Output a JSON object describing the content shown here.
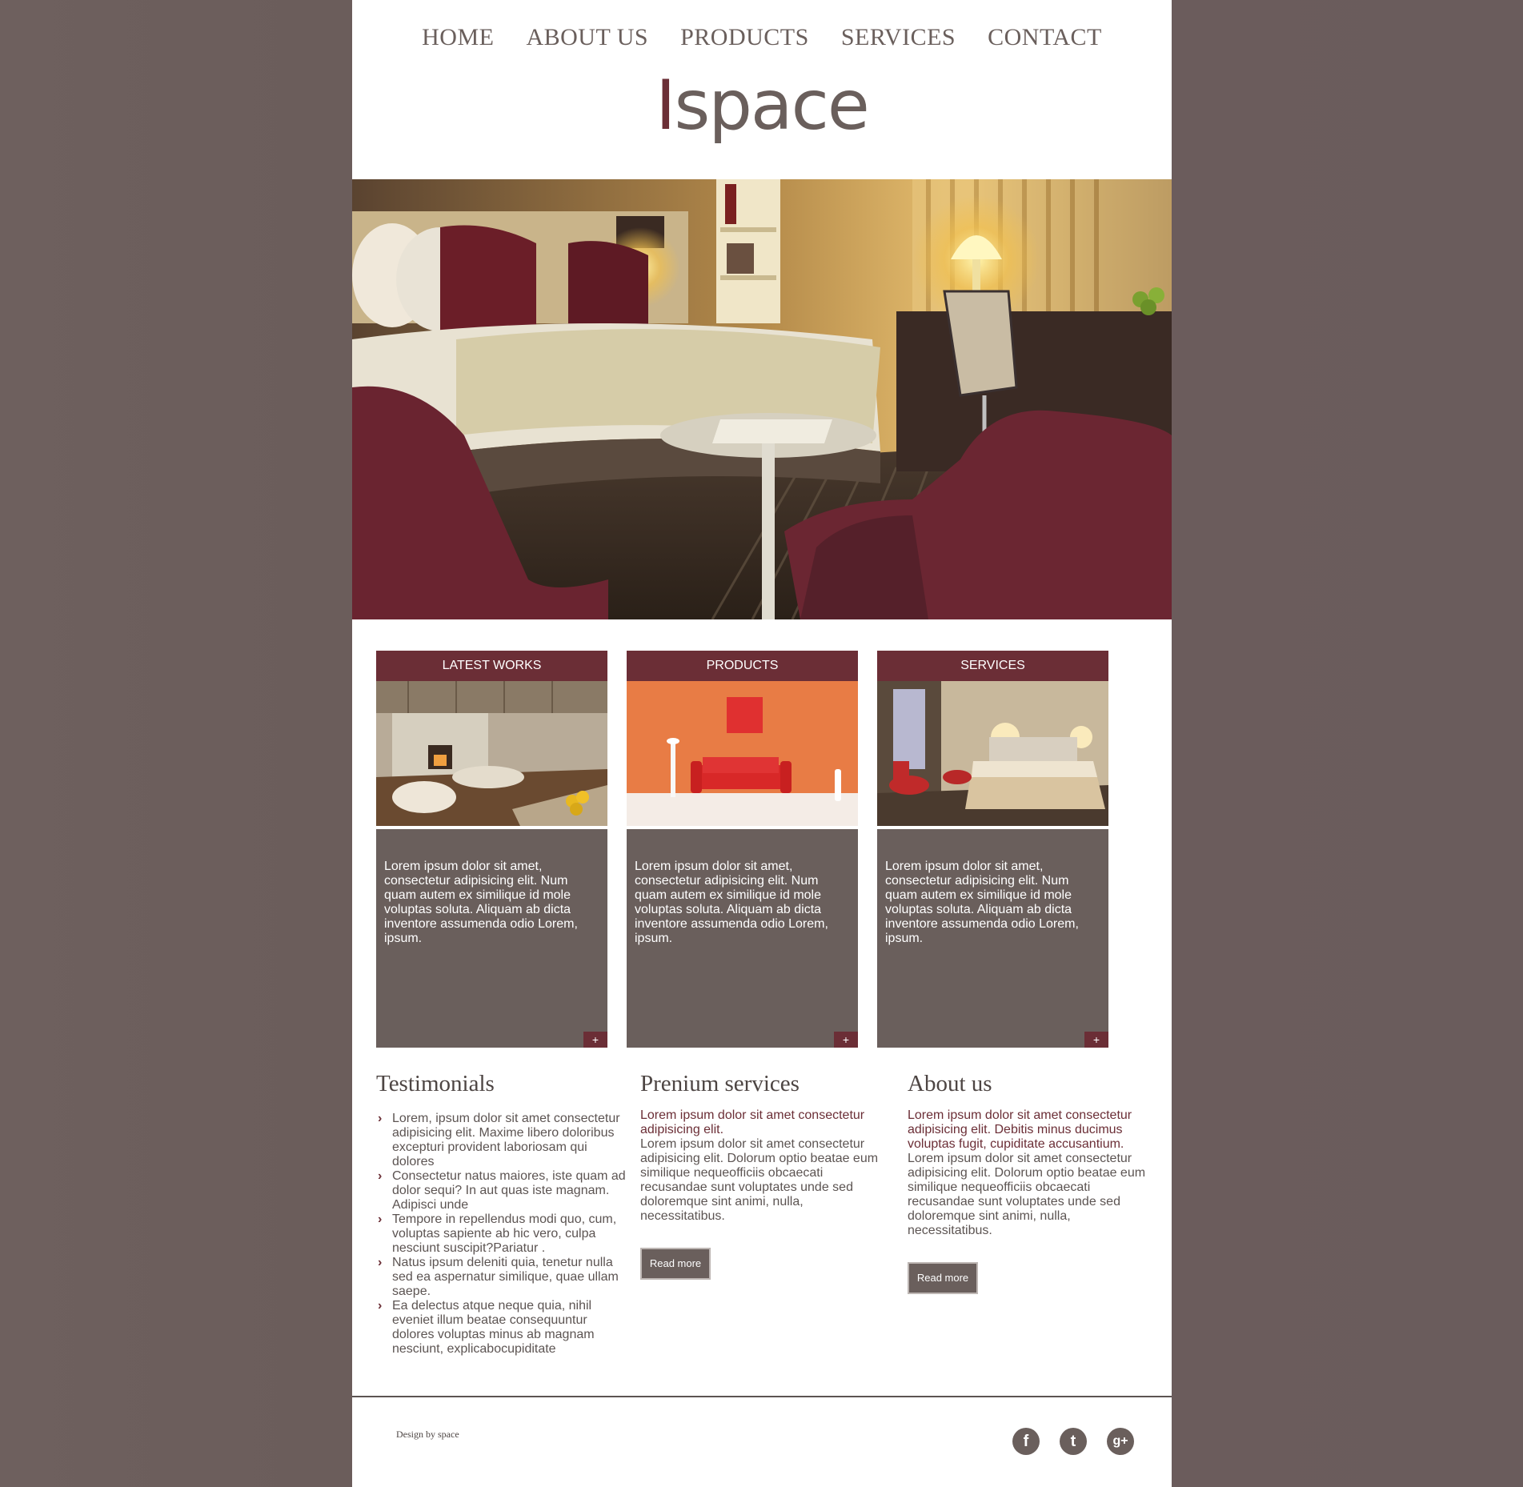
{
  "nav": {
    "items": [
      "HOME",
      "ABOUT US",
      "PRODUCTS",
      "SERVICES",
      "CONTACT"
    ]
  },
  "logo": {
    "first": "I",
    "rest": "space"
  },
  "cards": [
    {
      "title": "LATEST WORKS",
      "text": "Lorem ipsum dolor sit amet, consectetur adipisicing elit. Num quam autem ex similique id mole voluptas soluta. Aliquam ab dicta inventore assumenda odio Lorem, ipsum.",
      "plus": "+"
    },
    {
      "title": "PRODUCTS",
      "text": "Lorem ipsum dolor sit amet, consectetur adipisicing elit. Num quam autem ex similique id mole voluptas soluta. Aliquam ab dicta inventore assumenda odio Lorem, ipsum.",
      "plus": "+"
    },
    {
      "title": "SERVICES",
      "text": "Lorem ipsum dolor sit amet, consectetur adipisicing elit. Num quam autem ex similique id mole voluptas soluta. Aliquam ab dicta inventore assumenda odio Lorem, ipsum.",
      "plus": "+"
    }
  ],
  "testimonials": {
    "title": "Testimonials",
    "items": [
      "Lorem, ipsum dolor sit amet consectetur adipisicing elit. Maxime libero doloribus excepturi provident laboriosam qui dolores",
      "Consectetur natus maiores, iste quam ad dolor sequi? In aut quas iste magnam. Adipisci unde",
      "Tempore in repellendus modi quo, cum, voluptas sapiente ab hic vero, culpa nesciunt suscipit?Pariatur .",
      "Natus ipsum deleniti quia, tenetur nulla sed ea aspernatur similique, quae ullam saepe.",
      "Ea delectus atque neque quia, nihil eveniet illum beatae consequuntur dolores voluptas minus ab magnam nesciunt, explicabocupiditate"
    ]
  },
  "premium": {
    "title": "Prenium services",
    "accent": "Lorem ipsum dolor sit amet consectetur adipisicing elit.",
    "text": "Lorem ipsum dolor sit amet consectetur adipisicing elit. Dolorum optio beatae eum similique nequeofficiis obcaecati recusandae sunt voluptates unde sed doloremque sint animi, nulla, necessitatibus.",
    "button": "Read more"
  },
  "about": {
    "title": "About us",
    "accent": "Lorem ipsum dolor sit amet consectetur adipisicing elit. Debitis minus ducimus voluptas fugit, cupiditate accusantium.",
    "text": "Lorem ipsum dolor sit amet consectetur adipisicing elit. Dolorum optio beatae eum similique nequeofficiis obcaecati recusandae sunt voluptates unde sed doloremque sint animi, nulla, necessitatibus.",
    "button": "Read more"
  },
  "footer": {
    "credit": "Design by space",
    "social": [
      {
        "icon": "facebook-icon",
        "glyph": "f"
      },
      {
        "icon": "twitter-icon",
        "glyph": "t"
      },
      {
        "icon": "google-plus-icon",
        "glyph": "g+"
      }
    ]
  },
  "colors": {
    "accent": "#6b2e36",
    "panel": "#6a5f5c",
    "text": "#5c5452"
  }
}
